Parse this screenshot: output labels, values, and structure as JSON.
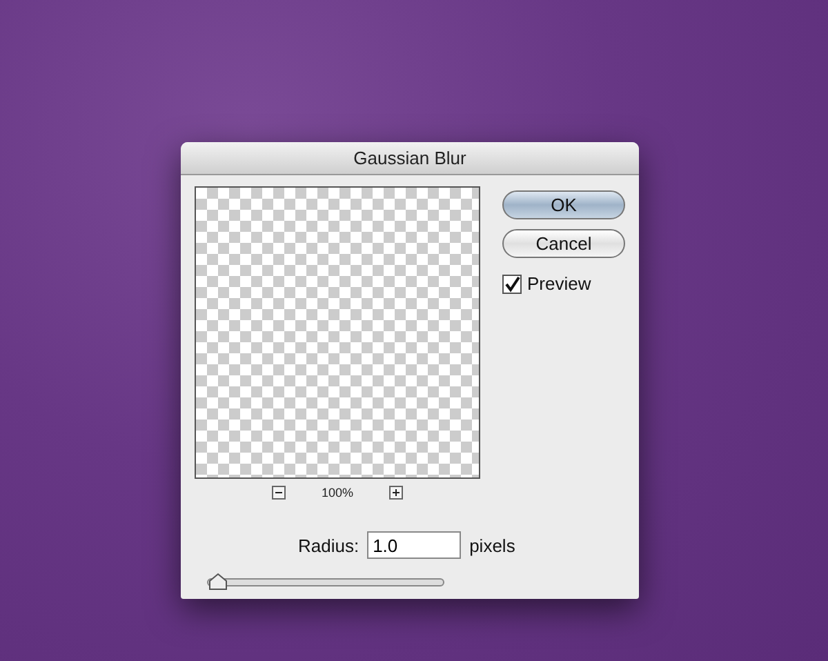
{
  "dialog": {
    "title": "Gaussian Blur",
    "preview": {
      "zoom": "100%"
    },
    "buttons": [
      {
        "label": "OK",
        "kind": "default"
      },
      {
        "label": "Cancel",
        "kind": "normal"
      }
    ],
    "preview_checkbox": {
      "label": "Preview",
      "checked": true
    },
    "radius": {
      "label": "Radius:",
      "value": "1.0",
      "unit": "pixels",
      "level": 0.04
    }
  }
}
